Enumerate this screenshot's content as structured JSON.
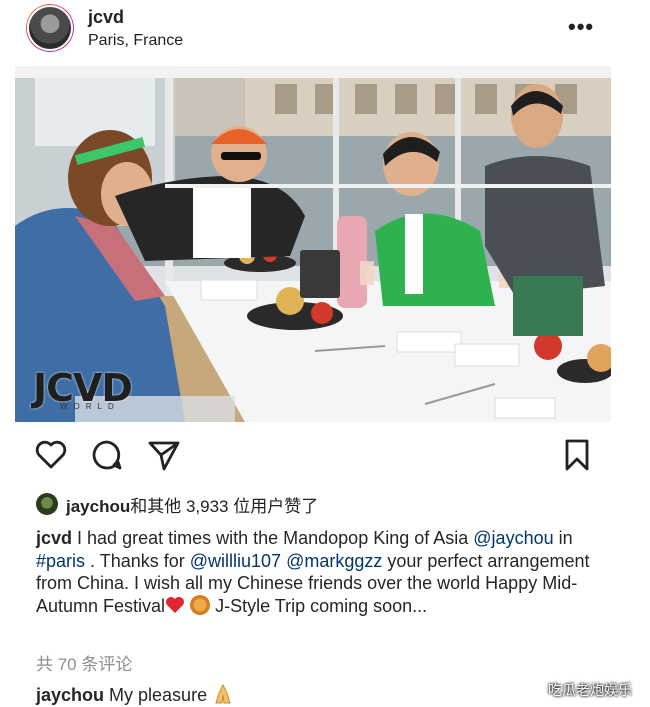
{
  "header": {
    "username": "jcvd",
    "location": "Paris, France",
    "more_icon": "more-horizontal-icon",
    "more_label": "•••"
  },
  "photo": {
    "watermark": "JCVD",
    "watermark_sub": "WORLD",
    "description_icon": "post-photo"
  },
  "actions": {
    "like_icon": "heart-icon",
    "comment_icon": "comment-icon",
    "share_icon": "send-icon",
    "save_icon": "bookmark-icon"
  },
  "likes": {
    "user": "jaychou",
    "text": "和其他 3,933 位用户赞了"
  },
  "caption": {
    "username": "jcvd",
    "part1": " I had great times with the Mandopop King of Asia ",
    "mention1": "@jaychou",
    "part2": " in ",
    "hashtag": "#paris",
    "part3": " . Thanks for  ",
    "mention2": "@willliu107",
    "part4": " ",
    "mention3": "@markggzz",
    "part5": " your perfect arrangement from China. I wish all my Chinese friends over the world Happy Mid-Autumn Festival",
    "part6": " J-Style Trip coming soon...",
    "emoji1": "red-heart",
    "emoji2": "moon-cake"
  },
  "comments": {
    "count_text": "共 70 条评论"
  },
  "reply": {
    "username": "jaychou",
    "text": " My pleasure",
    "emoji": "folded-hands"
  },
  "corner_watermark": "吃瓜老炮娱乐",
  "colors": {
    "link": "#00376b",
    "muted": "#8e8e8e",
    "text": "#262626"
  }
}
